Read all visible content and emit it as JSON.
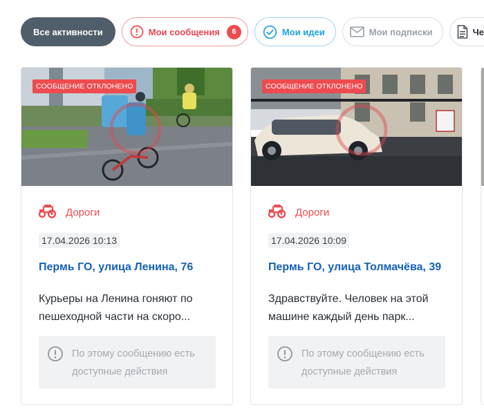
{
  "tabs": [
    {
      "label": "Все активности",
      "icon": "none",
      "active": true
    },
    {
      "label": "Мои сообщения",
      "icon": "alert-circle-icon",
      "badge": "6"
    },
    {
      "label": "Мои идеи",
      "icon": "check-circle-icon"
    },
    {
      "label": "Мои подписки",
      "icon": "envelope-icon"
    },
    {
      "label": "Черно",
      "icon": "document-icon"
    }
  ],
  "cards": [
    {
      "status": "СООБЩЕНИЕ ОТКЛОНЕНО",
      "category": "Дороги",
      "category_icon": "tractor-icon",
      "date": "17.04.2026 10:13",
      "address": "Пермь ГО, улица Ленина, 76",
      "text": "Курьеры на Ленина гоняют по пешеходной части на скоро...",
      "notice": "По этому сообщению есть доступные действия"
    },
    {
      "status": "СООБЩЕНИЕ ОТКЛОНЕНО",
      "category": "Дороги",
      "category_icon": "tractor-icon",
      "date": "17.04.2026 10:09",
      "address": "Пермь ГО, улица Толмачёва, 39",
      "text": "Здравствуйте. Человек на этой машине каждый день парк...",
      "notice": "По этому сообщению есть доступные действия"
    }
  ],
  "colors": {
    "accent_red": "#ee4b4f",
    "link_blue": "#1461b8",
    "ideas_blue": "#1da1de",
    "active_tab": "#4f5e6a"
  }
}
